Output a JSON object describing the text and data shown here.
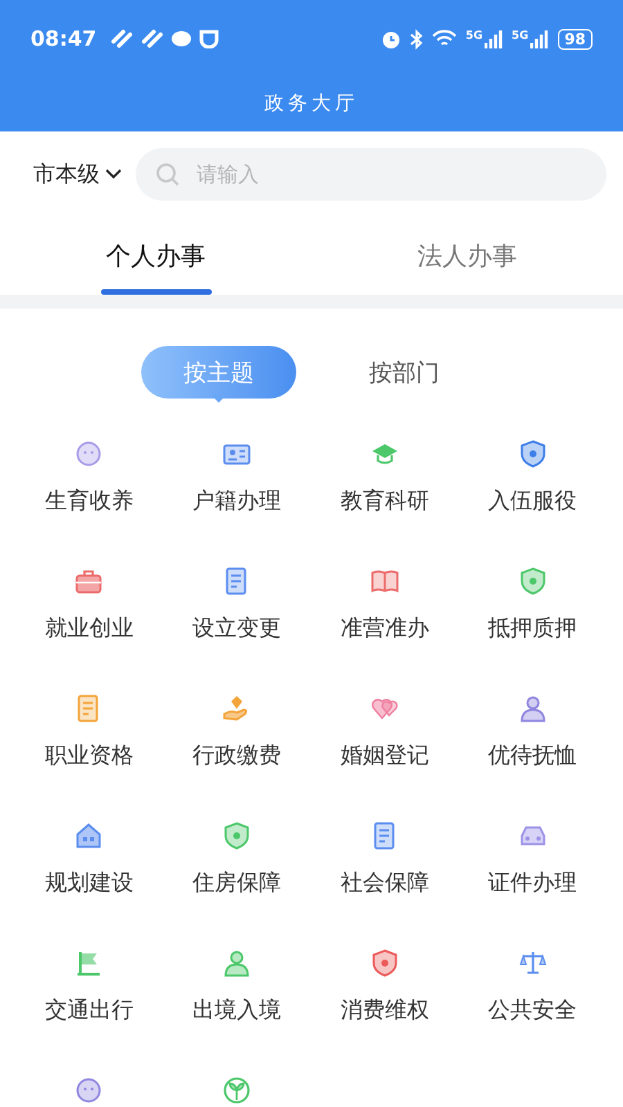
{
  "status_bar": {
    "time": "08:47",
    "network_1": "5G",
    "network_2": "5G",
    "battery": "98"
  },
  "title_bar": {
    "title": "政务大厅"
  },
  "search": {
    "region": "市本级",
    "placeholder": "请输入"
  },
  "tabs": [
    {
      "label": "个人办事",
      "selected": true
    },
    {
      "label": "法人办事",
      "selected": false
    }
  ],
  "segments": [
    {
      "label": "按主题",
      "selected": true
    },
    {
      "label": "按部门",
      "selected": false
    }
  ],
  "topics": [
    {
      "label": "生育收养",
      "kind": "face",
      "color": "#a99be8"
    },
    {
      "label": "户籍办理",
      "kind": "card",
      "color": "#5b8def"
    },
    {
      "label": "教育科研",
      "kind": "cap",
      "color": "#4cc76a"
    },
    {
      "label": "入伍服役",
      "kind": "shield",
      "color": "#3d7ee8"
    },
    {
      "label": "就业创业",
      "kind": "briefcase",
      "color": "#ec6b6b"
    },
    {
      "label": "设立变更",
      "kind": "doc",
      "color": "#5b8def"
    },
    {
      "label": "准营准办",
      "kind": "book",
      "color": "#ec6b6b"
    },
    {
      "label": "抵押质押",
      "kind": "shield",
      "color": "#4cc76a"
    },
    {
      "label": "职业资格",
      "kind": "doc",
      "color": "#f3a43a"
    },
    {
      "label": "行政缴费",
      "kind": "hand",
      "color": "#f3a43a"
    },
    {
      "label": "婚姻登记",
      "kind": "heart",
      "color": "#ef7fa0"
    },
    {
      "label": "优待抚恤",
      "kind": "person",
      "color": "#8f86e0"
    },
    {
      "label": "规划建设",
      "kind": "house",
      "color": "#5b8def"
    },
    {
      "label": "住房保障",
      "kind": "shield",
      "color": "#4cc76a"
    },
    {
      "label": "社会保障",
      "kind": "doc",
      "color": "#5b8def"
    },
    {
      "label": "证件办理",
      "kind": "car",
      "color": "#9c92e8"
    },
    {
      "label": "交通出行",
      "kind": "flag",
      "color": "#4cc76a"
    },
    {
      "label": "出境入境",
      "kind": "person",
      "color": "#4cc76a"
    },
    {
      "label": "消费维权",
      "kind": "shield",
      "color": "#ec5a5a"
    },
    {
      "label": "公共安全",
      "kind": "scale",
      "color": "#5b8def"
    },
    {
      "kind": "face",
      "color": "#8f86e0"
    },
    {
      "kind": "sprout",
      "color": "#4cc76a"
    }
  ]
}
